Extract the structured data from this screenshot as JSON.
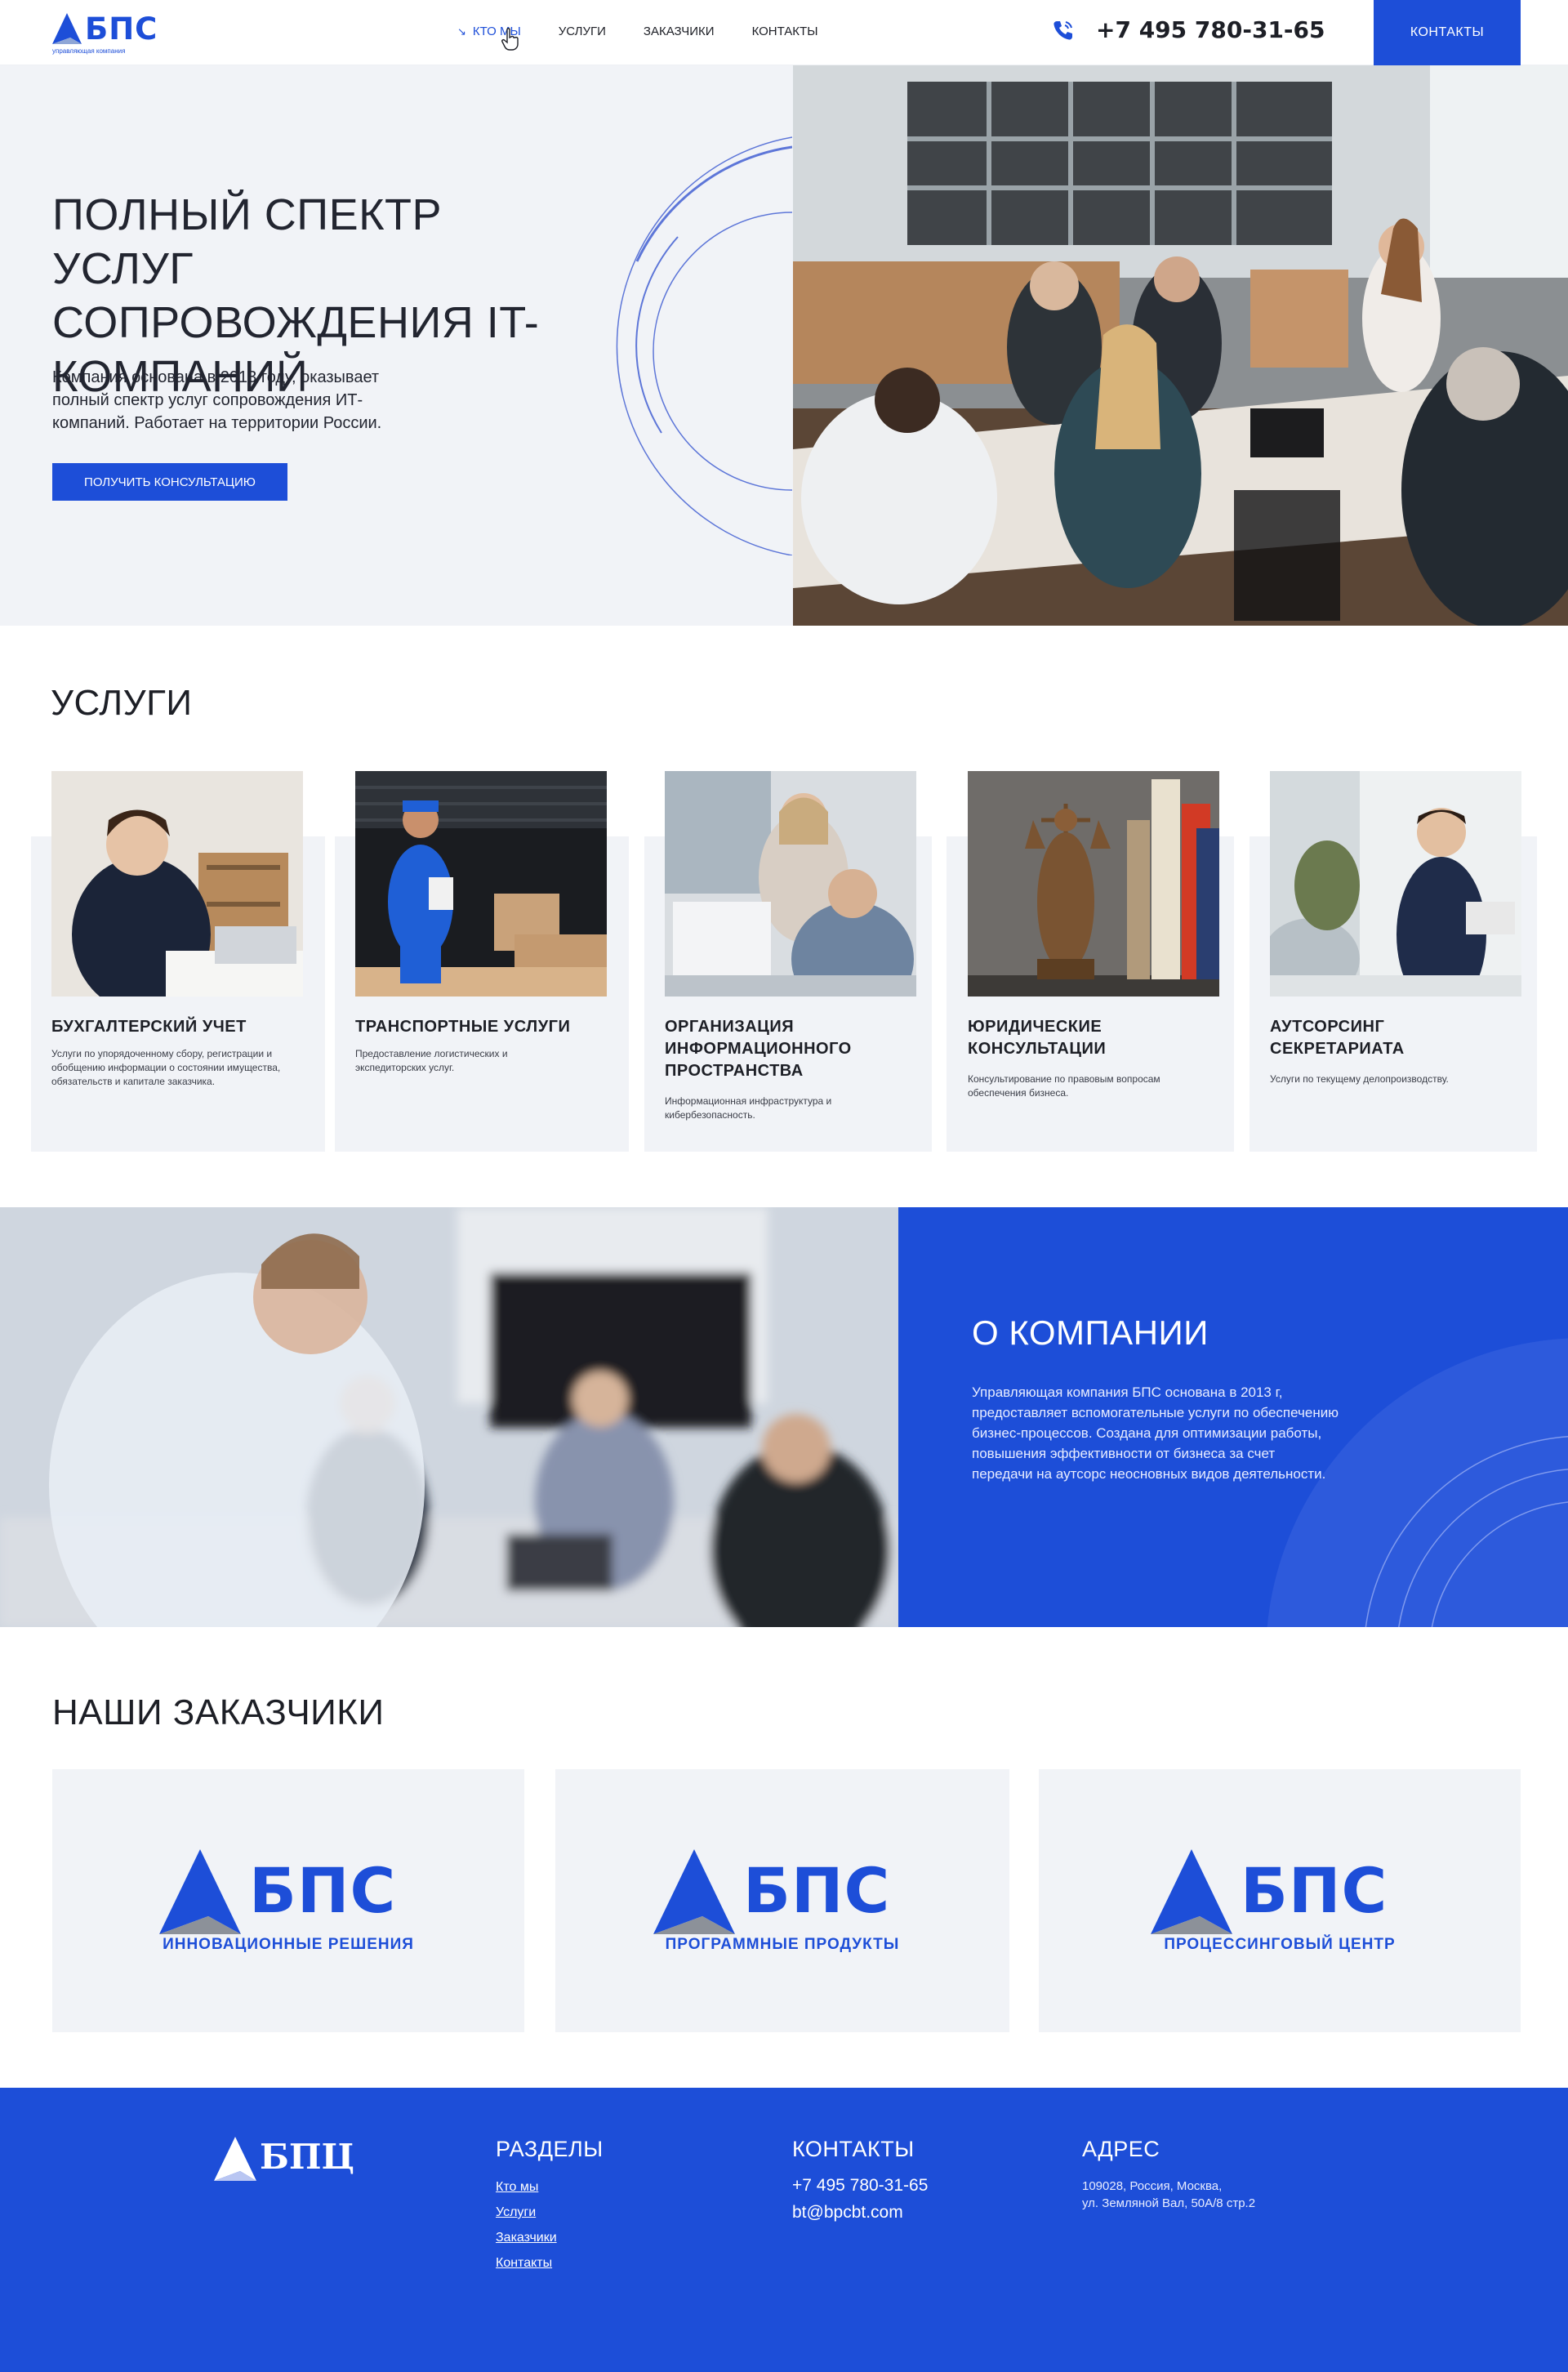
{
  "header": {
    "logo_text": "БПС",
    "logo_subtitle": "управляющая компания",
    "nav": [
      {
        "label": "Кто мы",
        "active": true
      },
      {
        "label": "Услуги"
      },
      {
        "label": "Заказчики"
      },
      {
        "label": "Контакты"
      }
    ],
    "phone": "+7 495 780-31-65",
    "contacts_button": "Контакты"
  },
  "hero": {
    "title": "Полный спектр услуг сопровождения IT-компаний",
    "description": "Компания основана в 2013 году, оказывает полный спектр услуг сопровождения ИТ-компаний. Работает на территории России.",
    "cta": "Получить консультацию"
  },
  "services": {
    "title": "Услуги",
    "items": [
      {
        "title": "Бухгалтерский учет",
        "description": "Услуги по упорядоченному сбору, регистрации и обобщению информации о состоянии имущества, обязательств и капитале заказчика."
      },
      {
        "title": "Транспортные услуги",
        "description": "Предоставление логистических и экспедиторских услуг."
      },
      {
        "title": "Организация информационного пространства",
        "description": "Информационная инфраструктура и кибербезопасность."
      },
      {
        "title": "Юридические консультации",
        "description": "Консультирование по правовым вопросам обеспечения бизнеса."
      },
      {
        "title": "Аутсорсинг секретариата",
        "description": "Услуги по текущему делопроизводству."
      }
    ]
  },
  "about": {
    "title": "О компании",
    "text": "Управляющая компания БПС основана в 2013 г, предоставляет вспомогательные услуги по обеспечению бизнес-процессов. Создана для оптимизации работы, повышения эффективности от бизнеса за счет передачи на аутсорс неосновных видов деятельности."
  },
  "clients": {
    "title": "Наши заказчики",
    "items": [
      {
        "name": "БПС",
        "caption": "Инновационные решения"
      },
      {
        "name": "БПС",
        "caption": "Программные продукты"
      },
      {
        "name": "БПС",
        "caption": "Процессинговый центр"
      }
    ]
  },
  "footer": {
    "logo_text": "БПЦ",
    "sections_title": "Разделы",
    "sections": [
      "Кто мы",
      "Услуги",
      "Заказчики",
      "Контакты"
    ],
    "contacts_title": "Контакты",
    "phone": "+7 495 780-31-65",
    "email": "bt@bpcbt.com",
    "address_title": "Адрес",
    "address_line1": "109028, Россия, Москва,",
    "address_line2": "ул. Земляной Вал, 50А/8 стр.2"
  },
  "colors": {
    "accent": "#1d4ed8",
    "light_bg": "#f1f3f7",
    "text": "#1d1f26"
  }
}
